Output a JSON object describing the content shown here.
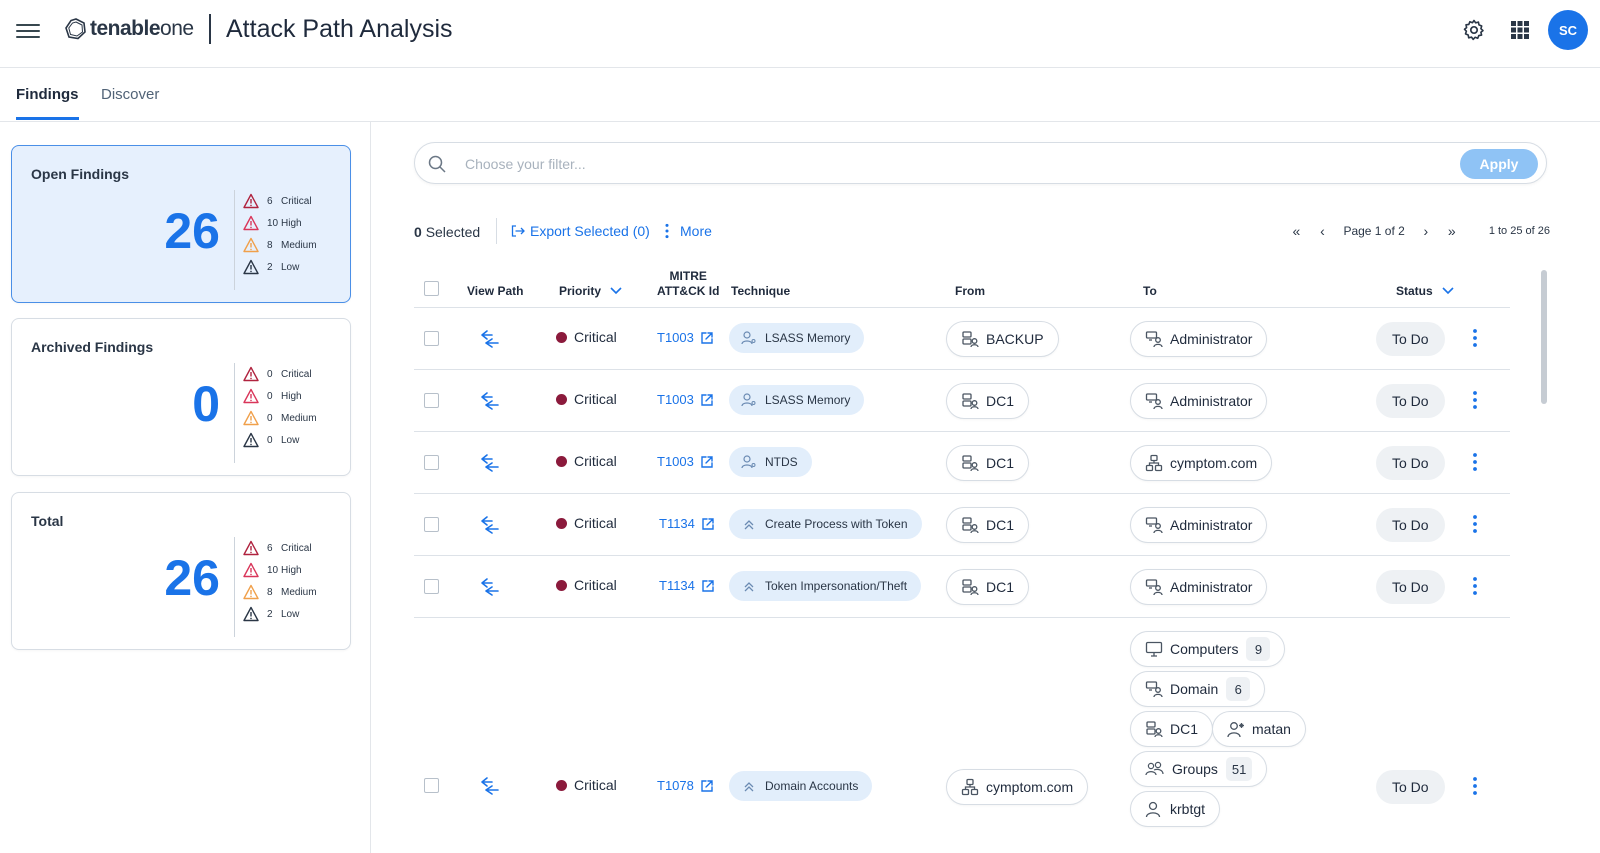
{
  "header": {
    "logo_brand": "tenable",
    "logo_product": "one",
    "title": "Attack Path Analysis",
    "avatar_initials": "SC",
    "accent_color": "#1a73e8"
  },
  "tabs": [
    {
      "label": "Findings",
      "active": true
    },
    {
      "label": "Discover",
      "active": false
    }
  ],
  "summary_cards": [
    {
      "title": "Open Findings",
      "total": "26",
      "critical": "6",
      "high": "10",
      "medium": "8",
      "low": "2"
    },
    {
      "title": "Archived Findings",
      "total": "0",
      "critical": "0",
      "high": "0",
      "medium": "0",
      "low": "0"
    },
    {
      "title": "Total",
      "total": "26",
      "critical": "6",
      "high": "10",
      "medium": "8",
      "low": "2"
    }
  ],
  "severity_labels": {
    "critical": "Critical",
    "high": "High",
    "medium": "Medium",
    "low": "Low"
  },
  "severity_colors": {
    "critical": "#b0233f",
    "high": "#d9365a",
    "medium": "#f0a04b",
    "low": "#2a3646"
  },
  "filter": {
    "placeholder": "Choose your filter...",
    "apply_label": "Apply"
  },
  "toolbar": {
    "selected_count": "0",
    "selected_label": "Selected",
    "export_label": "Export Selected (0)",
    "more_label": "More",
    "page_label": "Page 1 of 2",
    "range_label": "1 to 25 of 26"
  },
  "columns": {
    "view_path": "View Path",
    "priority": "Priority",
    "mitre_1": "MITRE",
    "mitre_2": "ATT&CK Id",
    "technique": "Technique",
    "from": "From",
    "to": "To",
    "status": "Status"
  },
  "rows": [
    {
      "priority": "Critical",
      "mitre": "T1003",
      "technique": "LSASS Memory",
      "from": "BACKUP",
      "to": "Administrator",
      "status": "To Do"
    },
    {
      "priority": "Critical",
      "mitre": "T1003",
      "technique": "LSASS Memory",
      "from": "DC1",
      "to": "Administrator",
      "status": "To Do"
    },
    {
      "priority": "Critical",
      "mitre": "T1003",
      "technique": "NTDS",
      "from": "DC1",
      "to": "cymptom.com",
      "status": "To Do"
    },
    {
      "priority": "Critical",
      "mitre": "T1134",
      "technique": "Create Process with Token",
      "from": "DC1",
      "to": "Administrator",
      "status": "To Do"
    },
    {
      "priority": "Critical",
      "mitre": "T1134",
      "technique": "Token Impersonation/Theft",
      "from": "DC1",
      "to": "Administrator",
      "status": "To Do"
    },
    {
      "priority": "Critical",
      "mitre": "T1078",
      "technique": "Domain Accounts",
      "from": "cymptom.com",
      "status": "To Do",
      "to_group": {
        "computers": "Computers",
        "computers_count": "9",
        "domain": "Domain",
        "domain_count": "6",
        "dc1": "DC1",
        "matan": "matan",
        "groups": "Groups",
        "groups_count": "51",
        "krbtgt": "krbtgt"
      }
    }
  ]
}
